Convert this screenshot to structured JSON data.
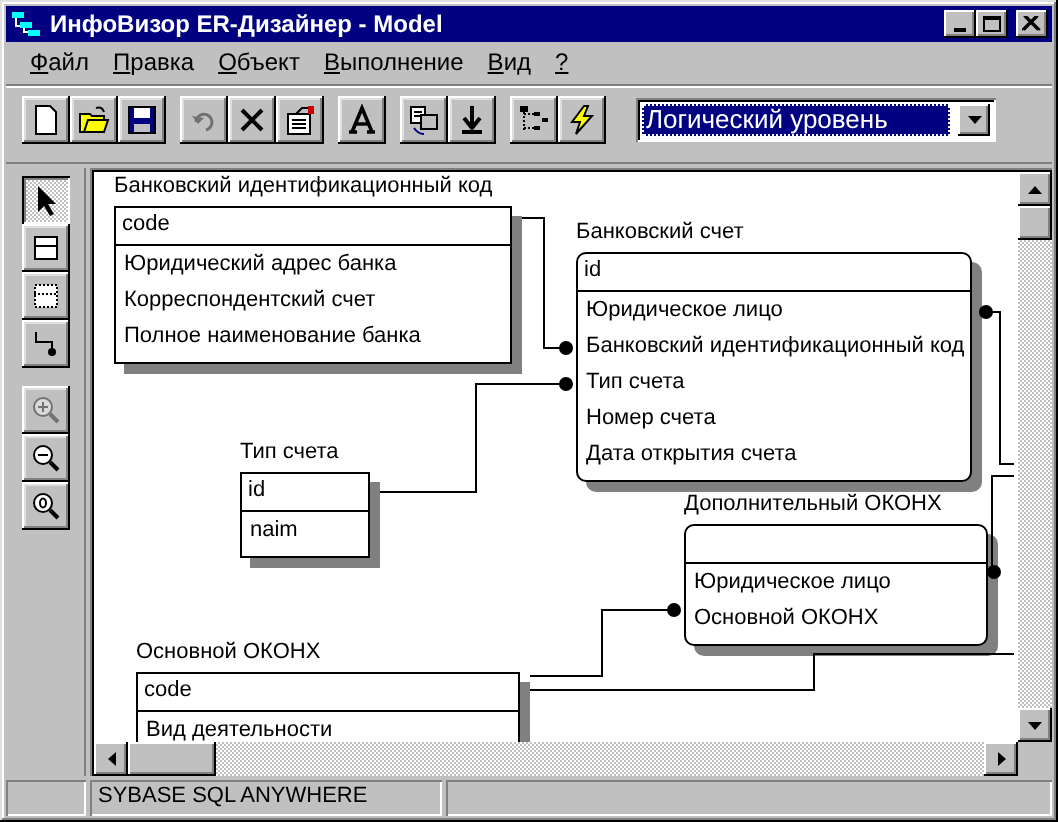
{
  "window": {
    "title": "ИнфоВизор ER-Дизайнер - Model"
  },
  "menu": [
    "Файл",
    "Правка",
    "Объект",
    "Выполнение",
    "Вид",
    "?"
  ],
  "toolbar": [
    {
      "kind": "new",
      "disabled": false
    },
    {
      "kind": "open",
      "disabled": false
    },
    {
      "kind": "save",
      "disabled": false
    },
    {
      "kind": "undo",
      "disabled": true
    },
    {
      "kind": "delete",
      "disabled": false
    },
    {
      "kind": "properties",
      "disabled": false
    },
    {
      "kind": "font",
      "disabled": false
    },
    {
      "kind": "layout",
      "disabled": false
    },
    {
      "kind": "import",
      "disabled": false
    },
    {
      "kind": "tree",
      "disabled": false
    },
    {
      "kind": "generate",
      "disabled": false
    }
  ],
  "level_selector": {
    "value": "Логический уровень"
  },
  "tools": [
    {
      "kind": "select",
      "selected": true,
      "disabled": false
    },
    {
      "kind": "entity",
      "selected": false,
      "disabled": false
    },
    {
      "kind": "view",
      "selected": false,
      "disabled": false
    },
    {
      "kind": "relation",
      "selected": false,
      "disabled": false
    },
    {
      "kind": "zoom-in",
      "selected": false,
      "disabled": true
    },
    {
      "kind": "zoom-out",
      "selected": false,
      "disabled": false
    },
    {
      "kind": "zoom-reset",
      "selected": false,
      "disabled": false
    }
  ],
  "entities": [
    {
      "name": "Банковский идентификационный код",
      "kind": "independent",
      "key": "code",
      "attributes": [
        "Юридический адрес банка",
        "Корреспондентский счет",
        "Полное наименование банка"
      ]
    },
    {
      "name": "Банковский счет",
      "kind": "dependent",
      "key": "id",
      "attributes": [
        "Юридическое лицо",
        "Банковский идентификационный код",
        "Тип счета",
        "Номер счета",
        "Дата открытия счета"
      ]
    },
    {
      "name": "Тип счета",
      "kind": "independent",
      "key": "id",
      "attributes": [
        "naim"
      ]
    },
    {
      "name": "Дополнительный ОКОНХ",
      "kind": "dependent",
      "attributes": [
        "Юридическое лицо",
        "Основной ОКОНХ"
      ]
    },
    {
      "name": "Основной ОКОНХ",
      "kind": "independent",
      "key": "code",
      "attributes": [
        "Вид деятельности"
      ]
    }
  ],
  "status_bar": {
    "text": "SYBASE SQL ANYWHERE"
  }
}
